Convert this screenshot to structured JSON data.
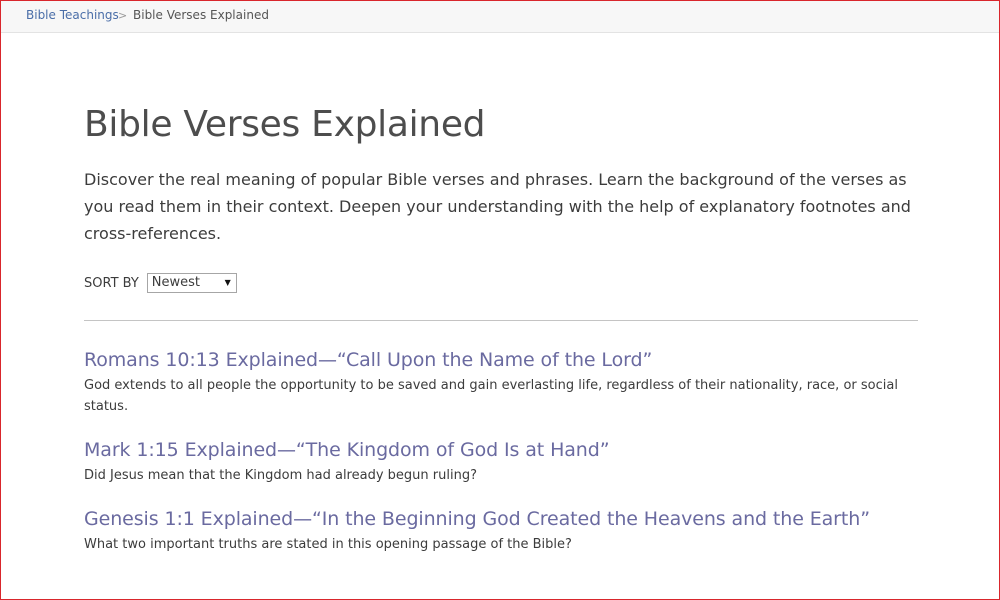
{
  "breadcrumb": {
    "parent": "Bible Teachings",
    "separator": ">",
    "current": "Bible Verses Explained"
  },
  "page": {
    "title": "Bible Verses Explained",
    "intro": "Discover the real meaning of popular Bible verses and phrases. Learn the background of the verses as you read them in their context. Deepen your understanding with the help of explanatory footnotes and cross-references."
  },
  "sort": {
    "label": "SORT BY",
    "selected": "Newest",
    "caret": "▼"
  },
  "articles": [
    {
      "title": "Romans 10:13 Explained—“Call Upon the Name of the Lord”",
      "description": "God extends to all people the opportunity to be saved and gain everlasting life, regardless of their nationality, race, or social status."
    },
    {
      "title": "Mark 1:15 Explained—“The Kingdom of God Is at Hand”",
      "description": "Did Jesus mean that the Kingdom had already begun ruling?"
    },
    {
      "title": "Genesis 1:1 Explained—“In the Beginning God Created the Heavens and the Earth”",
      "description": "What two important truths are stated in this opening passage of the Bible?"
    }
  ],
  "colors": {
    "link": "#4a6ea8",
    "article_title": "#6a6aa0",
    "frame_border": "#d9262c"
  }
}
